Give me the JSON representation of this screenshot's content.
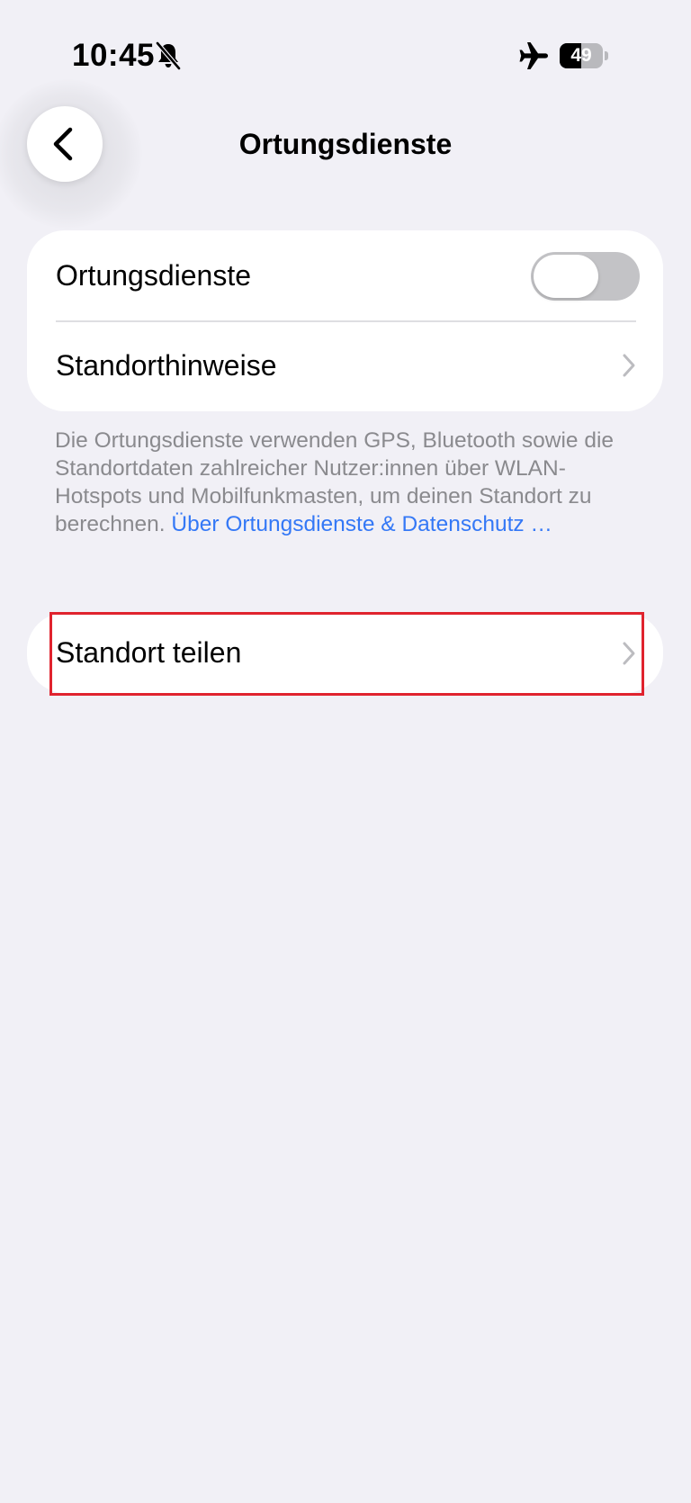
{
  "status_bar": {
    "time": "10:45",
    "battery_level": 49,
    "battery_text": "49",
    "icons": [
      "bell-slash-icon",
      "airplane-icon",
      "battery-icon"
    ]
  },
  "nav": {
    "back_icon": "chevron-left-icon",
    "title": "Ortungsdienste"
  },
  "group_1": {
    "location_services_label": "Ortungsdienste",
    "location_services_enabled": false,
    "location_hints_label": "Standorthinweise"
  },
  "footer": {
    "text": "Die Ortungsdienste verwenden GPS, Bluetooth sowie die Standortdaten zahlreicher Nutzer:innen über WLAN-Hotspots und Mobilfunkmasten, um deinen Standort zu berechnen.",
    "link": "Über Ortungsdienste & Datenschutz …"
  },
  "group_2": {
    "share_location_label": "Standort teilen"
  },
  "colors": {
    "background": "#f1f0f6",
    "card": "#ffffff",
    "link": "#3478f6",
    "secondary_text": "#8a8a8e",
    "toggle_off": "#c3c3c6",
    "highlight": "#e0232e"
  }
}
